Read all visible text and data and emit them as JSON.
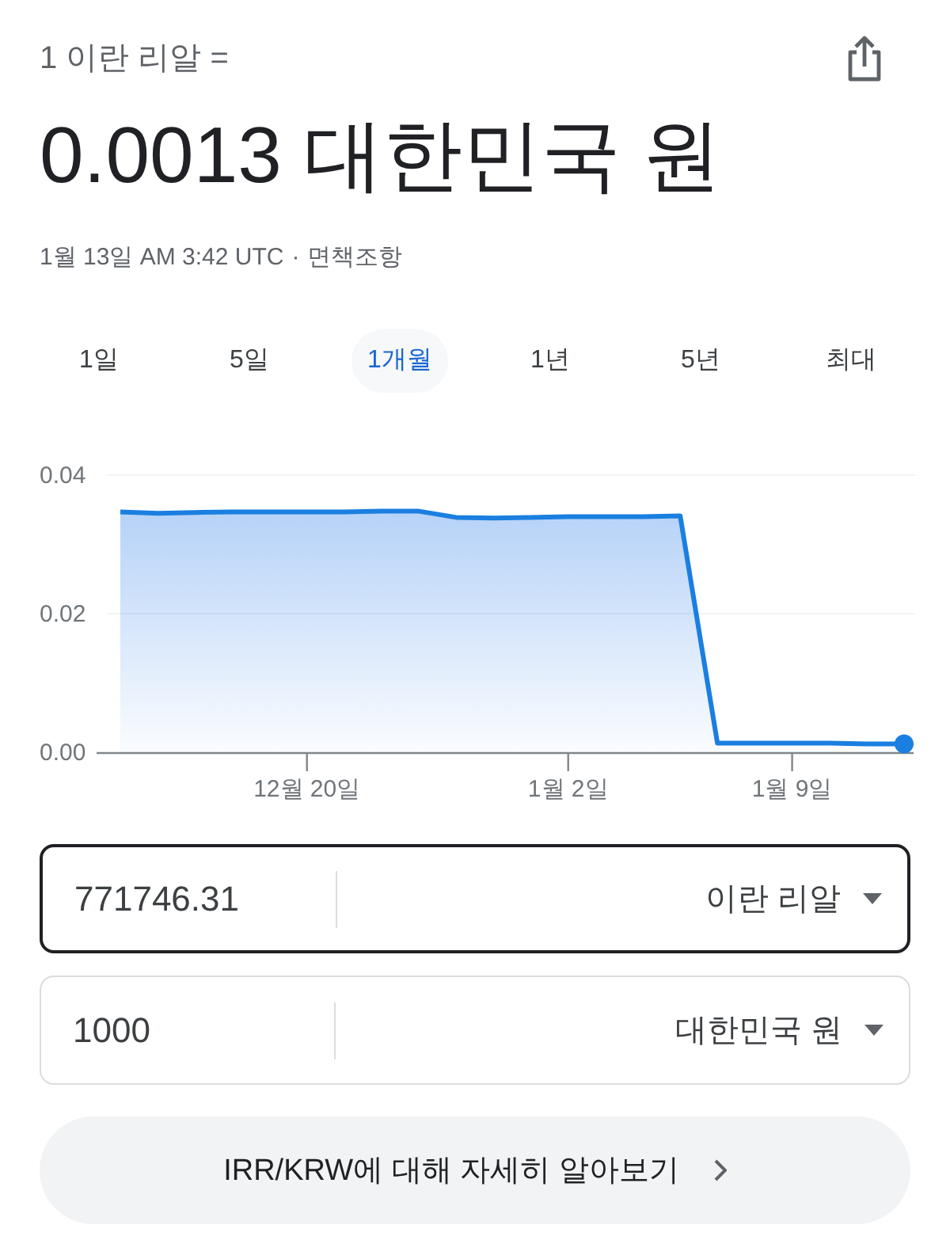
{
  "header": {
    "base": "1 이란 리알 =",
    "result": "0.0013 대한민국 원",
    "updated": "1월 13일 AM 3:42 UTC",
    "separator": "·",
    "disclaimer_link": "면책조항"
  },
  "range_tabs": [
    {
      "label": "1일",
      "selected": false
    },
    {
      "label": "5일",
      "selected": false
    },
    {
      "label": "1개월",
      "selected": true
    },
    {
      "label": "1년",
      "selected": false
    },
    {
      "label": "5년",
      "selected": false
    },
    {
      "label": "최대",
      "selected": false
    }
  ],
  "chart": {
    "chart_data": {
      "type": "area",
      "categories": [
        null,
        null,
        null,
        null,
        null,
        "12월 20일",
        null,
        null,
        null,
        null,
        null,
        null,
        "1월 2일",
        null,
        null,
        null,
        null,
        null,
        "1월 9일",
        null,
        null,
        null
      ],
      "values": [
        0.0347,
        0.0345,
        0.0346,
        0.0347,
        0.0347,
        0.0347,
        0.0347,
        0.0348,
        0.0348,
        0.0339,
        0.0338,
        0.0339,
        0.034,
        0.034,
        0.034,
        0.0341,
        0.0013,
        0.0013,
        0.0013,
        0.0013,
        0.0012,
        0.0012
      ],
      "ylim": [
        0,
        0.04
      ],
      "yticks": [
        {
          "value": 0,
          "label": "0.00"
        },
        {
          "value": 0.02,
          "label": "0.02"
        },
        {
          "value": 0.04,
          "label": "0.04"
        }
      ]
    }
  },
  "converter": [
    {
      "value": "771746.31",
      "currency": "이란 리알",
      "focused": true
    },
    {
      "value": "1000",
      "currency": "대한민국 원",
      "focused": false
    }
  ],
  "more_button": {
    "label": "IRR/KRW에 대해 자세히 알아보기"
  }
}
